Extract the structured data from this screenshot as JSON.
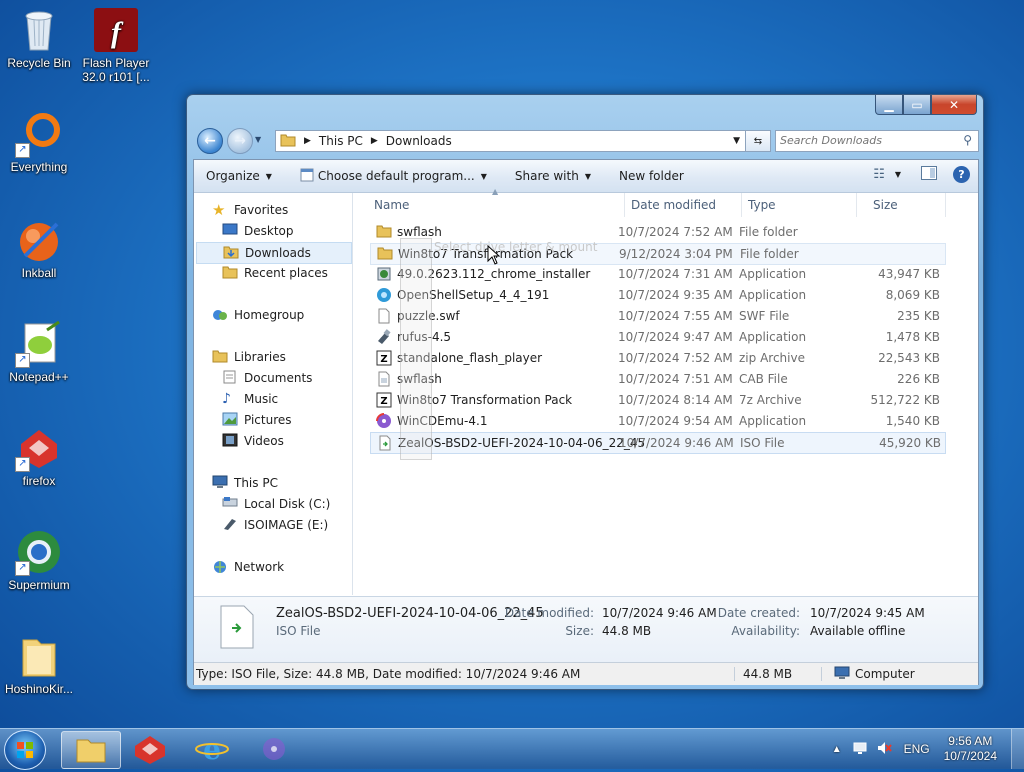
{
  "desktop": {
    "icons": [
      {
        "label": "Recycle Bin"
      },
      {
        "label": "Flash Player 32.0 r101 [..."
      },
      {
        "label": "Everything"
      },
      {
        "label": "Inkball"
      },
      {
        "label": "Notepad++"
      },
      {
        "label": "firefox"
      },
      {
        "label": "Supermium"
      },
      {
        "label": "HoshinoKir..."
      }
    ]
  },
  "window": {
    "address": {
      "root": "This PC",
      "current": "Downloads"
    },
    "search_placeholder": "Search Downloads",
    "commands": {
      "organize": "Organize",
      "default_program": "Choose default program...",
      "share_with": "Share with",
      "new_folder": "New folder"
    },
    "nav": {
      "favorites": "Favorites",
      "desktop": "Desktop",
      "downloads": "Downloads",
      "recent": "Recent places",
      "homegroup": "Homegroup",
      "libraries": "Libraries",
      "documents": "Documents",
      "music": "Music",
      "pictures": "Pictures",
      "videos": "Videos",
      "this_pc": "This PC",
      "local_disk": "Local Disk (C:)",
      "isoimage": "ISOIMAGE (E:)",
      "network": "Network"
    },
    "columns": {
      "name": "Name",
      "date": "Date modified",
      "type": "Type",
      "size": "Size"
    },
    "files": [
      {
        "name": "swflash",
        "date": "10/7/2024 7:52 AM",
        "type": "File folder",
        "size": ""
      },
      {
        "name": "Win8to7 Transformation Pack",
        "date": "9/12/2024 3:04 PM",
        "type": "File folder",
        "size": ""
      },
      {
        "name": "49.0.2623.112_chrome_installer",
        "date": "10/7/2024 7:31 AM",
        "type": "Application",
        "size": "43,947 KB"
      },
      {
        "name": "OpenShellSetup_4_4_191",
        "date": "10/7/2024 9:35 AM",
        "type": "Application",
        "size": "8,069 KB"
      },
      {
        "name": "puzzle.swf",
        "date": "10/7/2024 7:55 AM",
        "type": "SWF File",
        "size": "235 KB"
      },
      {
        "name": "rufus-4.5",
        "date": "10/7/2024 9:47 AM",
        "type": "Application",
        "size": "1,478 KB"
      },
      {
        "name": "standalone_flash_player",
        "date": "10/7/2024 7:52 AM",
        "type": "zip Archive",
        "size": "22,543 KB"
      },
      {
        "name": "swflash",
        "date": "10/7/2024 7:51 AM",
        "type": "CAB File",
        "size": "226 KB"
      },
      {
        "name": "Win8to7 Transformation Pack",
        "date": "10/7/2024 8:14 AM",
        "type": "7z Archive",
        "size": "512,722 KB"
      },
      {
        "name": "WinCDEmu-4.1",
        "date": "10/7/2024 9:54 AM",
        "type": "Application",
        "size": "1,540 KB"
      },
      {
        "name": "ZealOS-BSD2-UEFI-2024-10-04-06_22_45",
        "date": "10/7/2024 9:46 AM",
        "type": "ISO File",
        "size": "45,920 KB"
      }
    ],
    "drag_tooltip": "Select drive letter & mount",
    "details": {
      "filename": "ZealOS-BSD2-UEFI-2024-10-04-06_22_45",
      "filetype": "ISO File",
      "date_modified_label": "Date modified:",
      "date_modified": "10/7/2024 9:46 AM",
      "size_label": "Size:",
      "size": "44.8 MB",
      "date_created_label": "Date created:",
      "date_created": "10/7/2024 9:45 AM",
      "availability_label": "Availability:",
      "availability": "Available offline"
    },
    "status": {
      "text": "Type: ISO File, Size: 44.8 MB, Date modified: 10/7/2024 9:46 AM",
      "size": "44.8 MB",
      "location": "Computer"
    }
  },
  "taskbar": {
    "lang": "ENG",
    "time": "9:56 AM",
    "date": "10/7/2024"
  }
}
